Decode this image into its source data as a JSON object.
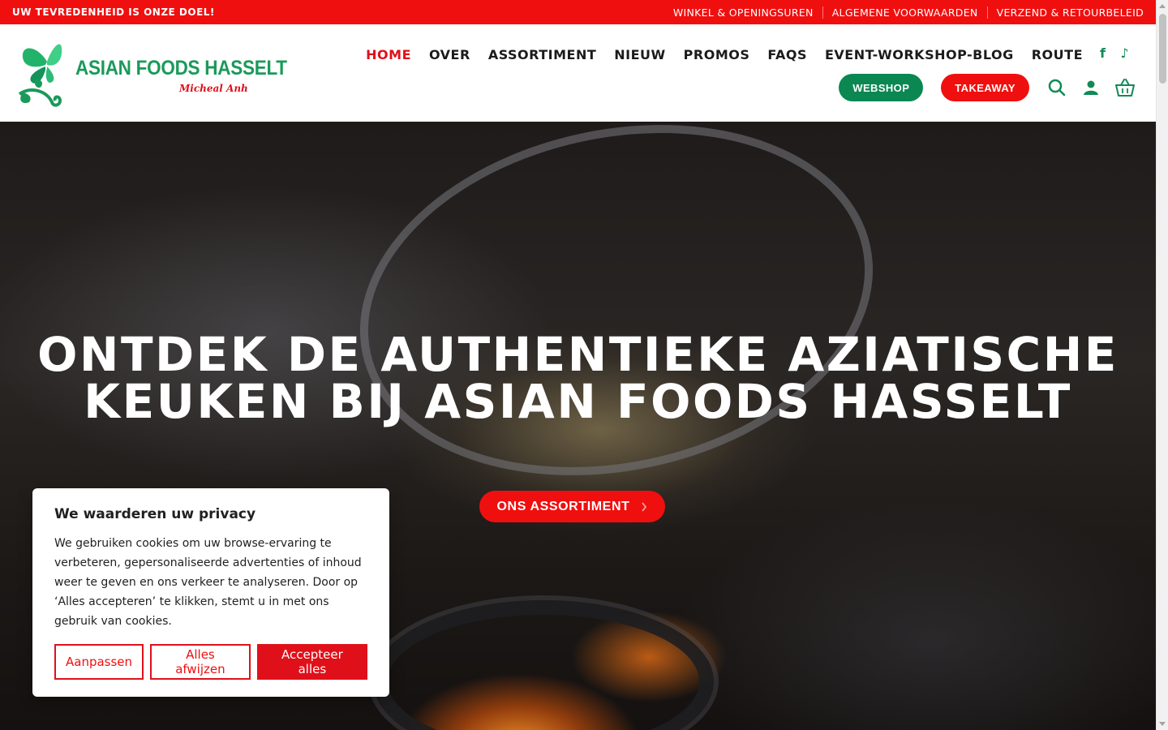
{
  "topbar": {
    "slogan": "UW TEVREDENHEID IS ONZE DOEL!",
    "links": [
      "WINKEL & OPENINGSUREN",
      "ALGEMENE VOORWAARDEN",
      "VERZEND & RETOURBELEID"
    ]
  },
  "logo": {
    "brand": "ASIAN FOODS HASSELT",
    "signature": "Micheal Anh"
  },
  "nav": {
    "items": [
      "HOME",
      "OVER",
      "ASSORTIMENT",
      "NIEUW",
      "PROMOS",
      "FAQS",
      "EVENT-WORKSHOP-BLOG",
      "ROUTE"
    ],
    "active": "HOME",
    "socials": [
      "facebook-icon",
      "tiktok-icon"
    ]
  },
  "actions": {
    "webshop_label": "WEBSHOP",
    "takeaway_label": "TAKEAWAY",
    "icons": [
      "search-icon",
      "user-icon",
      "basket-icon"
    ]
  },
  "hero": {
    "title": "ONTDEK DE AUTHENTIEKE AZIATISCHE KEUKEN BIJ ASIAN FOODS HASSELT",
    "cta_label": "ONS ASSORTIMENT",
    "cta_icon": "chevron-right-icon"
  },
  "cookie": {
    "title": "We waarderen uw privacy",
    "text": "We gebruiken cookies om uw browse-ervaring te verbeteren, gepersonaliseerde advertenties of inhoud weer te geven en ons verkeer te analyseren. Door op ‘Alles accepteren’ te klikken, stemt u in met ons gebruik van cookies.",
    "customize_label": "Aanpassen",
    "reject_label": "Alles afwijzen",
    "accept_label": "Accepteer alles"
  },
  "colors": {
    "brand_red": "#f00f0f",
    "brand_green": "#0b8752",
    "text_dark": "#1b1b1b"
  }
}
